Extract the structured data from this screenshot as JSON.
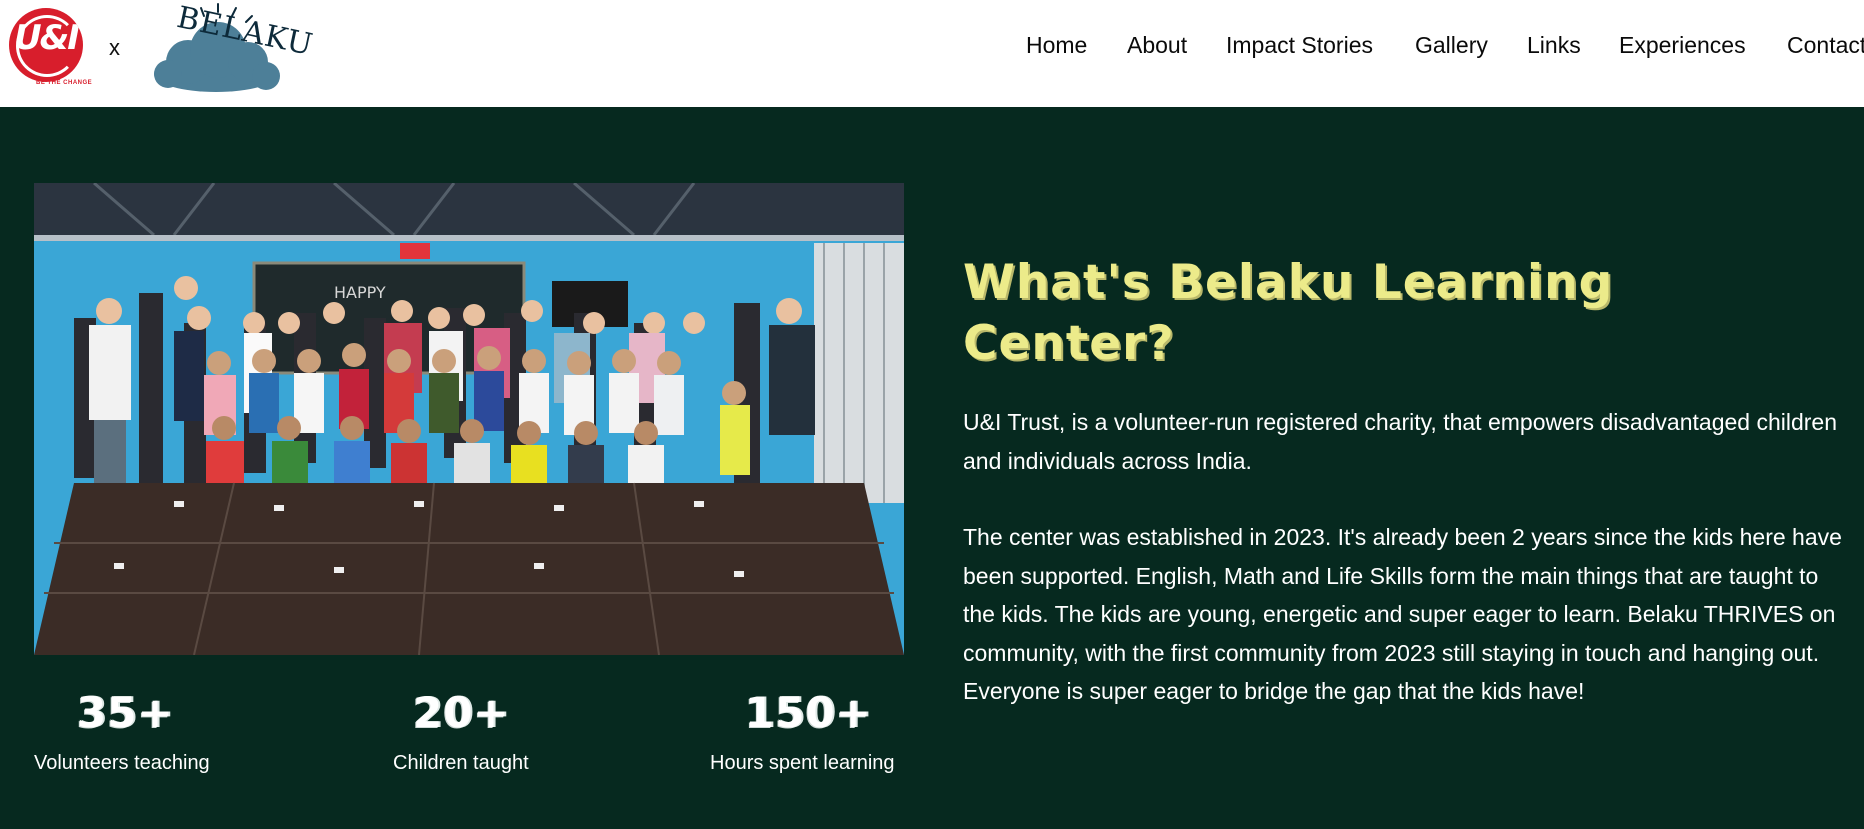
{
  "header": {
    "ui_logo_text": "U&I",
    "ui_logo_caption": "BE THE CHANGE",
    "separator": "x",
    "belaku_logo_text": "BELAKU",
    "nav": [
      "Home",
      "About",
      "Impact Stories",
      "Gallery",
      "Links",
      "Experiences",
      "Contact"
    ]
  },
  "main": {
    "headline": "What's Belaku Learning Center?",
    "paragraph_1": "U&I Trust, is a volunteer-run registered charity, that empowers disadvantaged children and individuals across India.",
    "paragraph_2": "The center was established in 2023. It's already been 2 years since the kids here have been supported. English, Math and Life Skills form the main things that are taught to the kids. The kids are young, energetic and super eager to learn. Belaku THRIVES on community, with the first community from 2023 still staying in touch and hanging out. Everyone is super eager to bridge the gap that the kids have!",
    "photo_board_text": "HAPPY",
    "stats": [
      {
        "value": "35+",
        "label": "Volunteers teaching"
      },
      {
        "value": "20+",
        "label": "Children taught"
      },
      {
        "value": "150+",
        "label": "Hours spent learning"
      }
    ]
  },
  "colors": {
    "background": "#06291f",
    "headline": "#eceb8a",
    "ui_red": "#d81e2c",
    "belaku_cloud": "#4d7f98"
  }
}
